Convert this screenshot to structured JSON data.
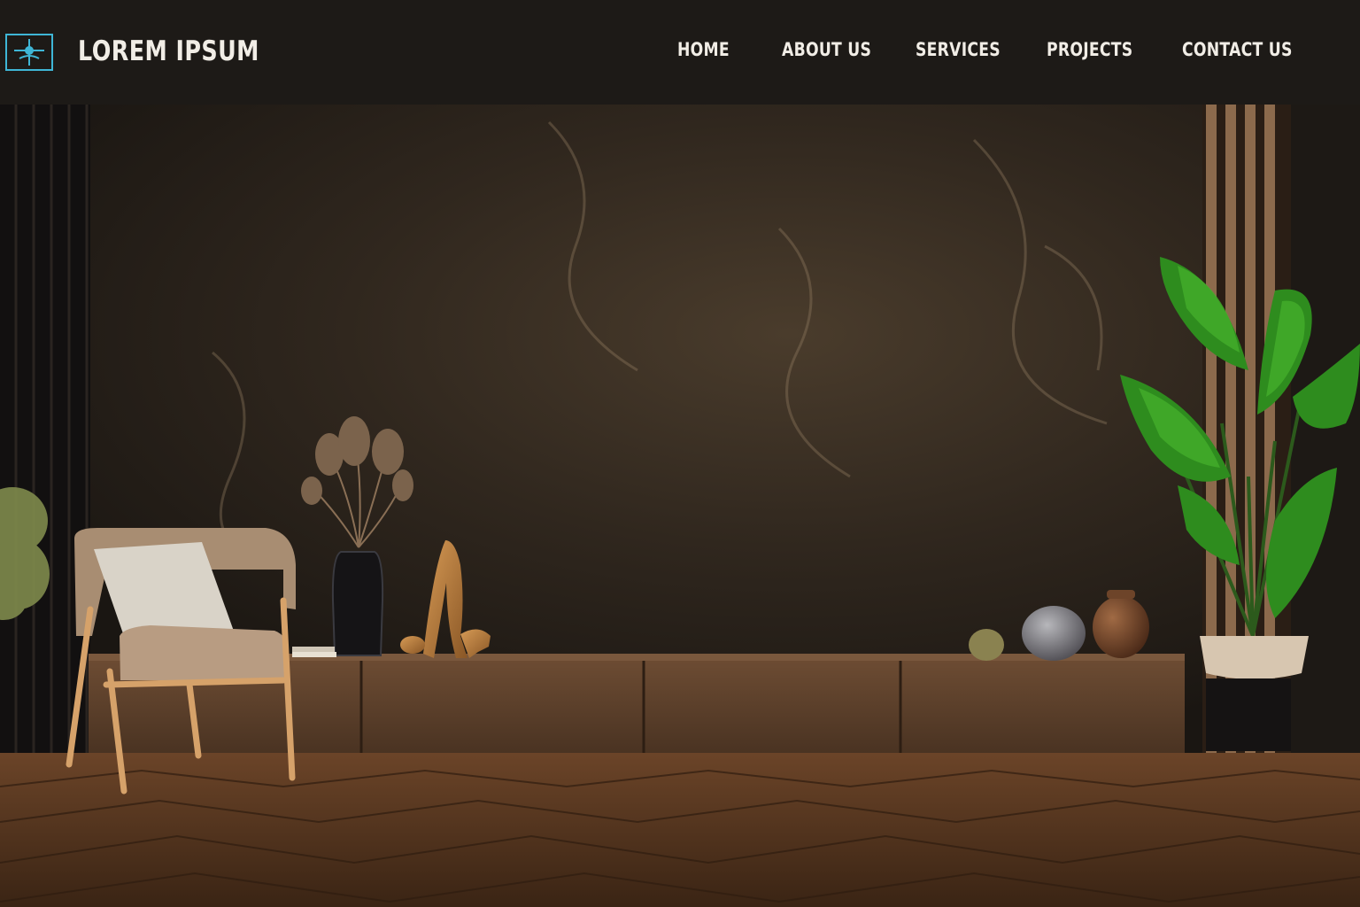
{
  "header": {
    "brand": "LOREM IPSUM",
    "logo_icon": "logo-frame-icon",
    "accent_color": "#3fb6d6"
  },
  "nav": {
    "items": [
      {
        "label": "HOME"
      },
      {
        "label": "ABOUT US"
      },
      {
        "label": "SERVICES"
      },
      {
        "label": "PROJECTS"
      },
      {
        "label": "CONTACT US"
      }
    ]
  },
  "hero": {
    "image": "interior-room-image"
  }
}
